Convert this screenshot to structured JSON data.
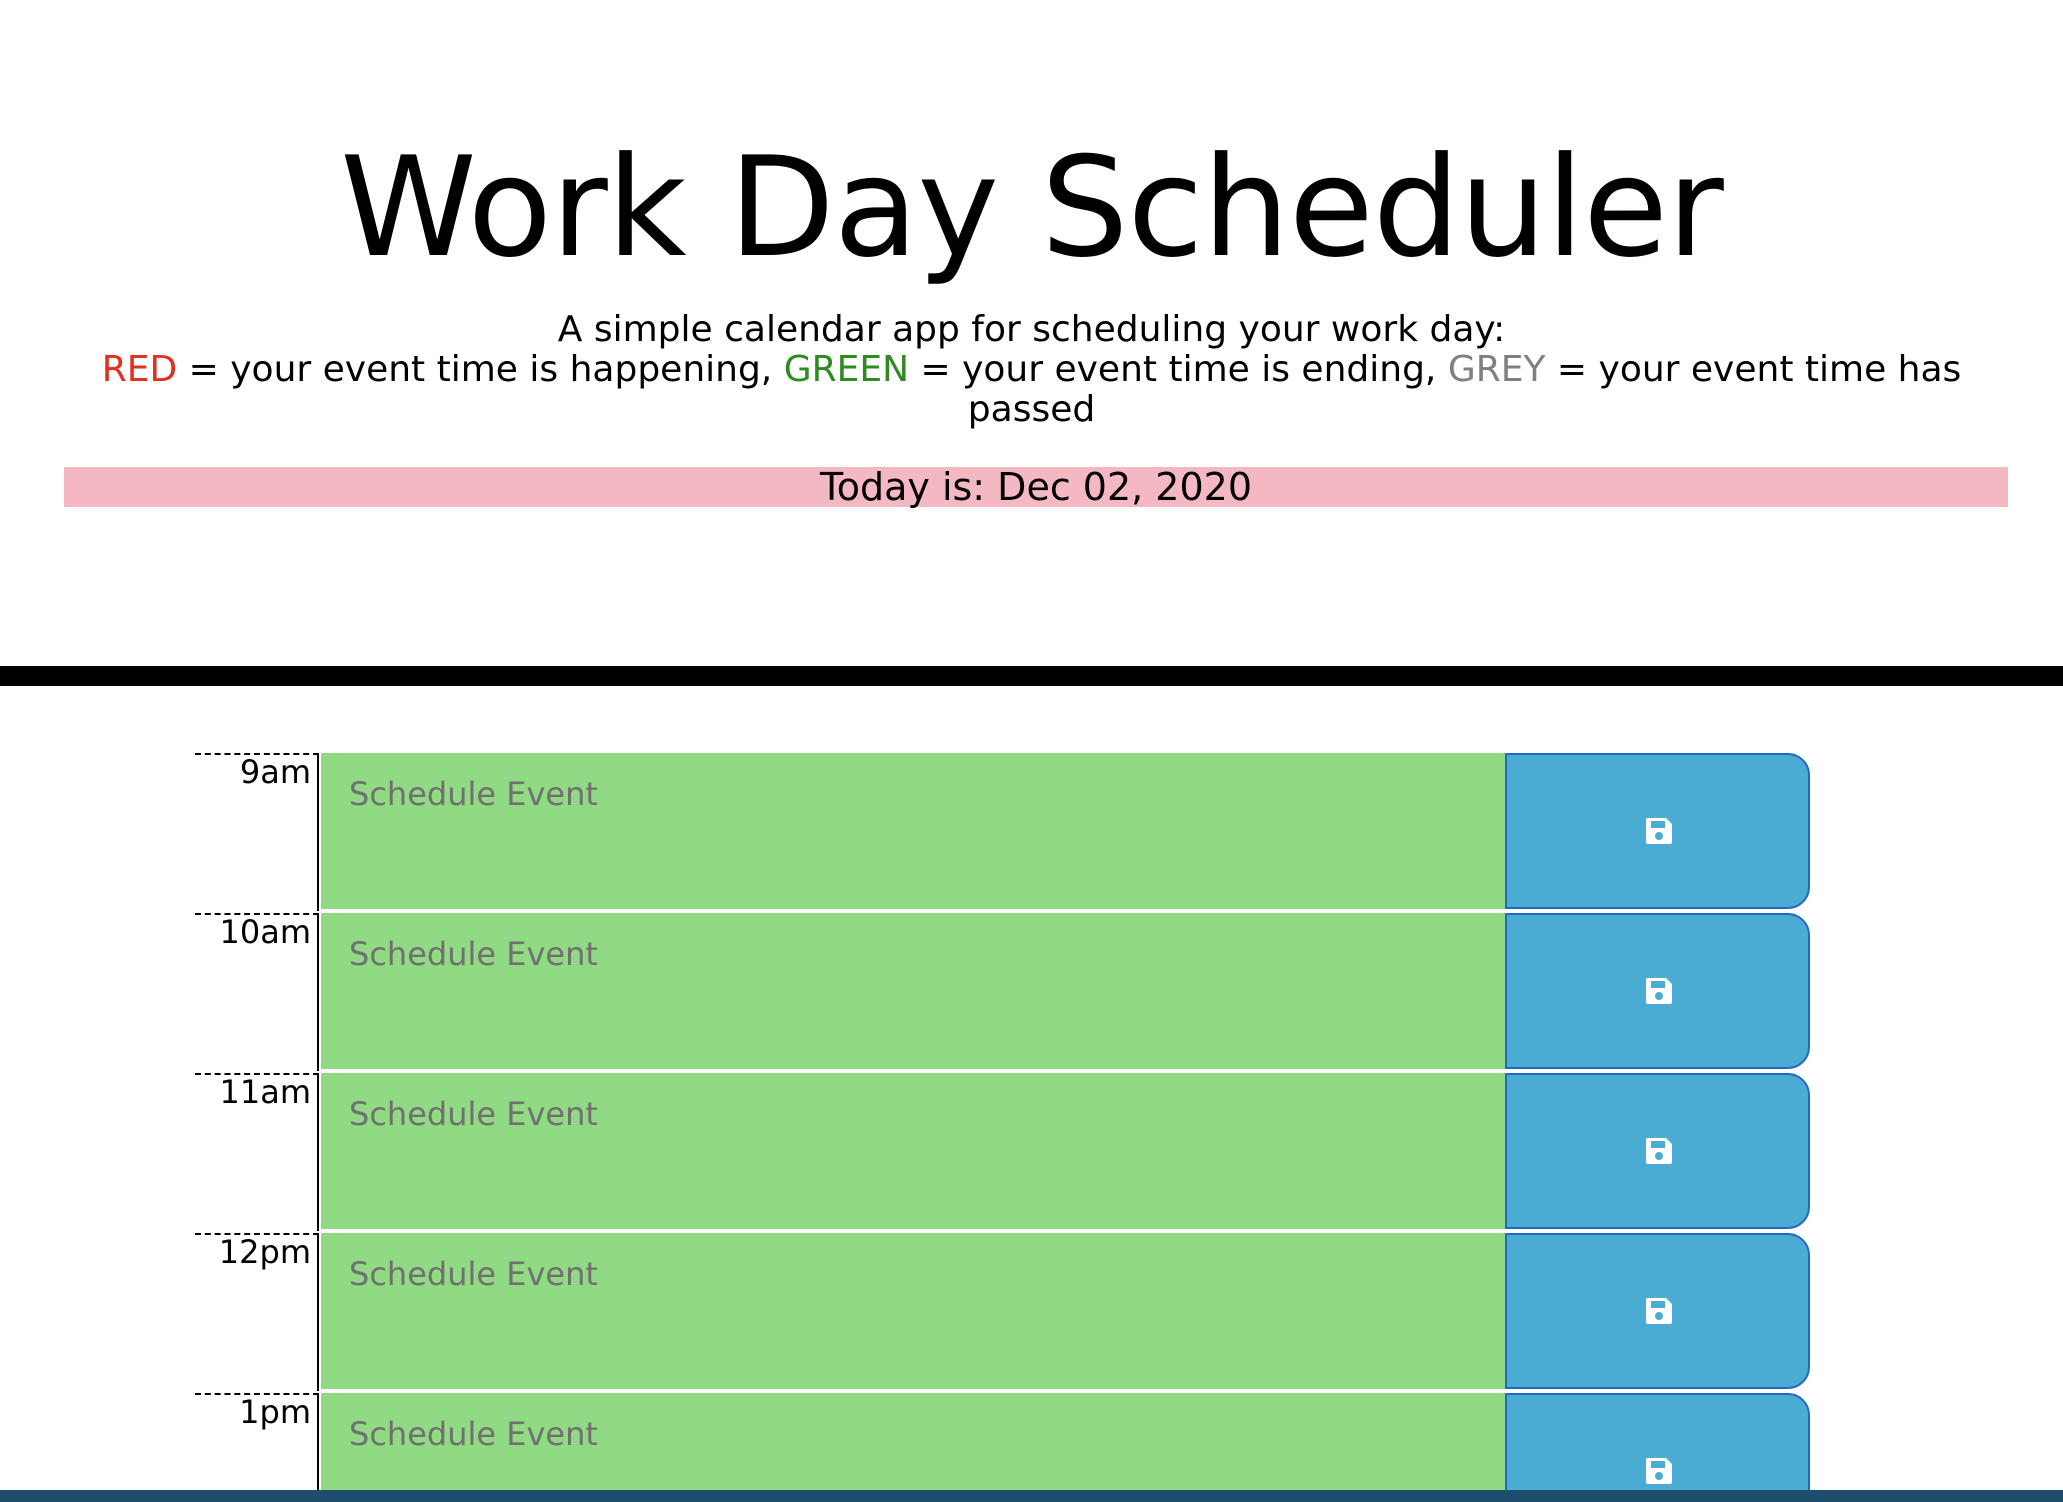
{
  "header": {
    "title": "Work Day Scheduler",
    "lead_line1": "A simple calendar app for scheduling your work day:",
    "legend": {
      "red_label": "RED",
      "red_text": " = your event time is happening, ",
      "green_label": "GREEN",
      "green_text": " = your event time is ending, ",
      "grey_label": "GREY",
      "grey_text": " = your event time has passed"
    },
    "today": "Today is: Dec 02, 2020"
  },
  "colors": {
    "red": "#e0301e",
    "green": "#2e8b1f",
    "grey": "#808080",
    "today_bg": "#f4b8c3",
    "event_bg": "#8fda83",
    "save_bg": "#4aabd3"
  },
  "schedule": {
    "placeholder": "Schedule Event",
    "save_icon": "floppy-disk-icon",
    "hours": [
      {
        "label": "9am"
      },
      {
        "label": "10am"
      },
      {
        "label": "11am"
      },
      {
        "label": "12pm"
      },
      {
        "label": "1pm"
      }
    ]
  }
}
